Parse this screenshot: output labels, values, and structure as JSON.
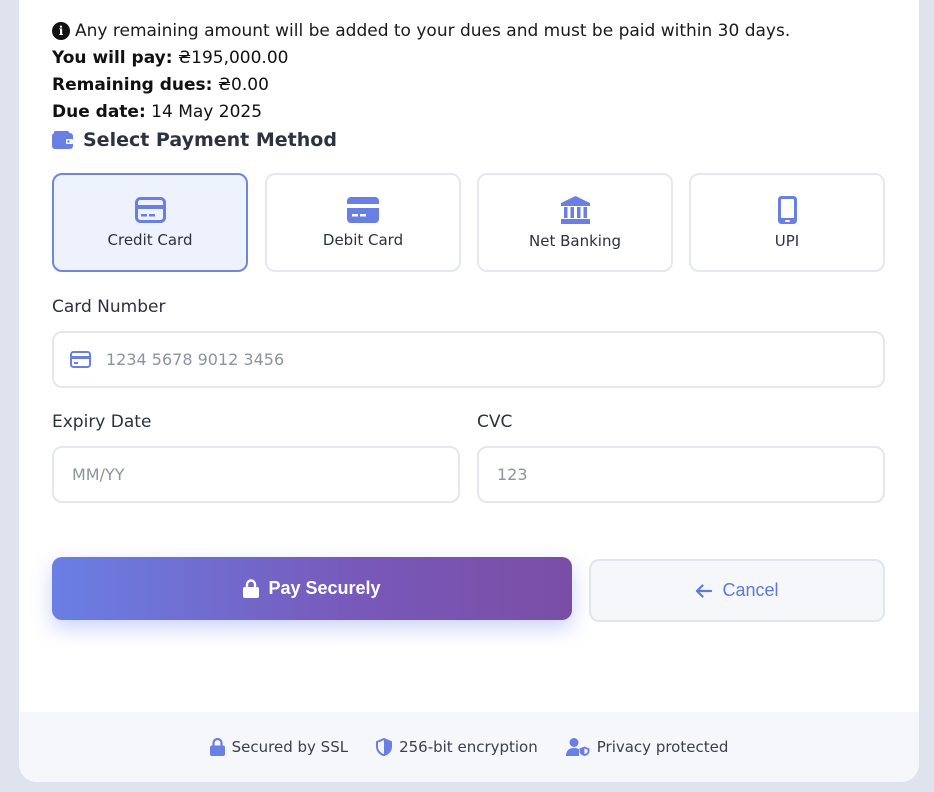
{
  "notice": {
    "text": "Any remaining amount will be added to your dues and must be paid within 30 days.",
    "icon": "info-icon"
  },
  "summary": {
    "pay_label": "You will pay:",
    "pay_value": "₴195,000.00",
    "dues_label": "Remaining dues:",
    "dues_value": "₴0.00",
    "due_label": "Due date:",
    "due_value": "14 May 2025"
  },
  "payment_section": {
    "title": "Select Payment Method",
    "icon": "wallet-icon"
  },
  "methods": [
    {
      "label": "Credit Card",
      "icon": "credit-card-icon",
      "selected": true
    },
    {
      "label": "Debit Card",
      "icon": "debit-card-icon",
      "selected": false
    },
    {
      "label": "Net Banking",
      "icon": "bank-icon",
      "selected": false
    },
    {
      "label": "UPI",
      "icon": "mobile-icon",
      "selected": false
    }
  ],
  "form": {
    "card_number_label": "Card Number",
    "card_number_placeholder": "1234 5678 9012 3456",
    "expiry_label": "Expiry Date",
    "expiry_placeholder": "MM/YY",
    "cvc_label": "CVC",
    "cvc_placeholder": "123"
  },
  "actions": {
    "pay_label": "Pay Securely",
    "cancel_label": "Cancel"
  },
  "footer": {
    "ssl": "Secured by SSL",
    "encryption": "256-bit encryption",
    "privacy": "Privacy protected"
  },
  "colors": {
    "accent": "#6a7fe4",
    "accent_end": "#7a4ea5",
    "icon": "#6a7fe4"
  }
}
